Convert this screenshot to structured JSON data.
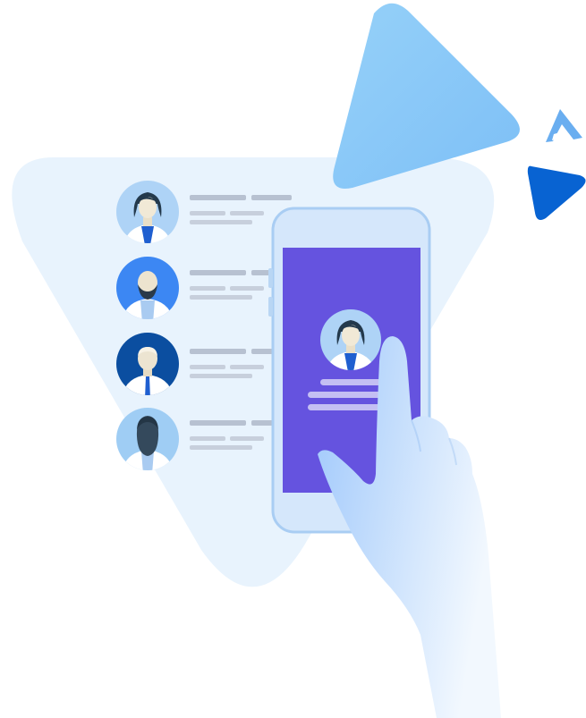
{
  "colors": {
    "background": "#ffffff",
    "big_triangle": "#e8f3fd",
    "top_triangle": "#8fcdf8",
    "small_triangle": "#0863d2",
    "logo_mark": "#6aaef0",
    "phone_body": "#d5e7fb",
    "phone_outline": "#a9cdf3",
    "phone_screen": "#6553df",
    "text_placeholder_light": "#c7cfdc",
    "text_placeholder_dark": "#b7c1d1",
    "hand_start": "#9fc8fb",
    "hand_end": "#f2f8fe"
  },
  "doctor_list": [
    {
      "avatar": "female-doctor-avatar",
      "ring_color": "#aed3f6",
      "hair_color": "#23394c",
      "skin_color": "#f1e9d6"
    },
    {
      "avatar": "bald-bearded-doctor-avatar",
      "ring_color": "#3c87f3",
      "hair_color": "#2a3a4a",
      "skin_color": "#ede4cf"
    },
    {
      "avatar": "bald-doctor-with-tie-avatar",
      "ring_color": "#0b4ea0",
      "hair_color": "#f1e9d6",
      "skin_color": "#ece4d1"
    },
    {
      "avatar": "dark-skinned-doctor-avatar",
      "ring_color": "#9fcdf4",
      "hair_color": "#243646",
      "skin_color": "#34495c"
    }
  ],
  "phone": {
    "profile_avatar": "female-doctor-avatar",
    "icons": [
      "pointing-hand-icon",
      "logo-a-icon"
    ]
  }
}
